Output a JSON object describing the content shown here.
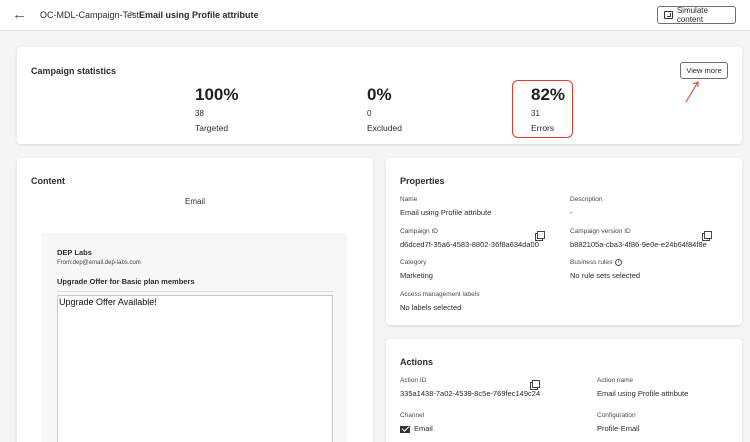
{
  "header": {
    "back_icon": "arrow-left-icon",
    "breadcrumb": "OC-MDL-Campaign-Test",
    "separator": ">",
    "title": "Email using Profile attribute",
    "simulate_label": "Simulate content",
    "simulate_icon": "preview-icon"
  },
  "stats": {
    "title": "Campaign statistics",
    "view_more_label": "View more",
    "items": [
      {
        "percent": "100%",
        "count": "38",
        "label": "Targeted"
      },
      {
        "percent": "0%",
        "count": "0",
        "label": "Excluded"
      },
      {
        "percent": "82%",
        "count": "31",
        "label": "Errors"
      }
    ],
    "highlight_color": "#e3372f"
  },
  "content": {
    "title": "Content",
    "channel": "Email",
    "preview": {
      "sender": "DEP Labs",
      "from": "From:dep@email.dep-labs.com",
      "subject": "Upgrade Offer for Basic plan members",
      "body": "Upgrade Offer Available!"
    }
  },
  "properties": {
    "title": "Properties",
    "name_label": "Name",
    "name_value": "Email using Profile attribute",
    "description_label": "Description",
    "description_value": "-",
    "campaign_id_label": "Campaign ID",
    "campaign_id_value": "d6dced7f-35a6-4583-8802-36f8a634da00",
    "version_id_label": "Campaign version ID",
    "version_id_value": "b882105a-cba3-4f86-9e0e-e24b64f84f8e",
    "category_label": "Category",
    "category_value": "Marketing",
    "business_rules_label": "Business rules",
    "business_rules_value": "No rule sets selected",
    "access_label": "Access management labels",
    "access_value": "No labels selected"
  },
  "actions": {
    "title": "Actions",
    "action_id_label": "Action ID",
    "action_id_value": "335a1438-7a02-4539-8c5e-769fec149c24",
    "action_name_label": "Action name",
    "action_name_value": "Email using Profile attribute",
    "channel_label": "Channel",
    "channel_value": "Email",
    "configuration_label": "Configuration",
    "configuration_value": "Profile-Email"
  }
}
